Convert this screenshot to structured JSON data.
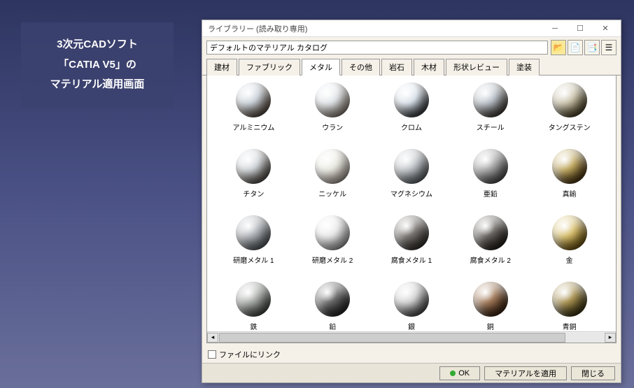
{
  "caption": {
    "line1": "3次元CADソフト",
    "line2": "「CATIA V5」の",
    "line3": "マテリアル適用画面"
  },
  "window": {
    "title": "ライブラリー (読み取り専用)",
    "dropdown_value": "デフォルトのマテリアル カタログ",
    "toolbar_icons": [
      "folder-open-icon",
      "page-icon",
      "page2-icon",
      "list-icon"
    ],
    "tabs": [
      {
        "label": "建材",
        "active": false
      },
      {
        "label": "ファブリック",
        "active": false
      },
      {
        "label": "メタル",
        "active": true
      },
      {
        "label": "その他",
        "active": false
      },
      {
        "label": "岩石",
        "active": false
      },
      {
        "label": "木材",
        "active": false
      },
      {
        "label": "形状レビュー",
        "active": false
      },
      {
        "label": "塗装",
        "active": false
      }
    ],
    "materials": [
      {
        "label": "アルミニウム",
        "color1": "#c8d0d8",
        "color2": "#5a5048"
      },
      {
        "label": "ウラン",
        "color1": "#e0e4e8",
        "color2": "#888078"
      },
      {
        "label": "クロム",
        "color1": "#d8e0e8",
        "color2": "#404448"
      },
      {
        "label": "スチール",
        "color1": "#b8c0c8",
        "color2": "#484440"
      },
      {
        "label": "タングステン",
        "color1": "#c8c0a8",
        "color2": "#504830"
      },
      {
        "label": "チタン",
        "color1": "#d0d4d8",
        "color2": "#585450"
      },
      {
        "label": "ニッケル",
        "color1": "#e8e8e0",
        "color2": "#a09890"
      },
      {
        "label": "マグネシウム",
        "color1": "#c0c4c8",
        "color2": "#606468"
      },
      {
        "label": "亜鉛",
        "color1": "#a8a8a8",
        "color2": "#505050"
      },
      {
        "label": "真鍮",
        "color1": "#c0a860",
        "color2": "#503c18"
      },
      {
        "label": "研磨メタル 1",
        "color1": "#b0b4b8",
        "color2": "#585c60"
      },
      {
        "label": "研磨メタル 2",
        "color1": "#e8e8e8",
        "color2": "#989898"
      },
      {
        "label": "腐食メタル 1",
        "color1": "#787470",
        "color2": "#383430"
      },
      {
        "label": "腐食メタル 2",
        "color1": "#686460",
        "color2": "#282420"
      },
      {
        "label": "金",
        "color1": "#d8c070",
        "color2": "#705818"
      },
      {
        "label": "鉄",
        "color1": "#a8aca8",
        "color2": "#484c48"
      },
      {
        "label": "鉛",
        "color1": "#686868",
        "color2": "#282828"
      },
      {
        "label": "銀",
        "color1": "#d0d0d0",
        "color2": "#505050"
      },
      {
        "label": "銅",
        "color1": "#a07858",
        "color2": "#402818"
      },
      {
        "label": "青銅",
        "color1": "#a89050",
        "color2": "#403818"
      }
    ],
    "checkbox_label": "ファイルにリンク",
    "buttons": {
      "ok": "OK",
      "apply": "マテリアルを適用",
      "close": "閉じる"
    }
  }
}
